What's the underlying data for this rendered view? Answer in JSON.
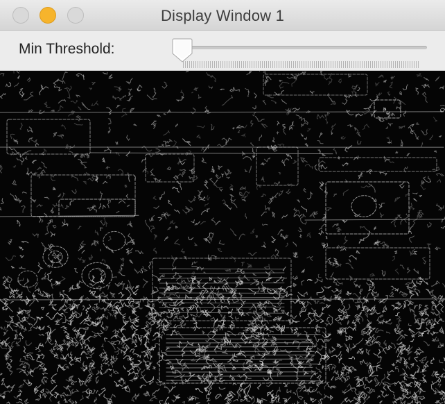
{
  "window": {
    "title": "Display Window 1",
    "buttons": {
      "close_color": "#d9d9d9",
      "minimize_color": "#f6b42c",
      "zoom_color": "#d9d9d9"
    }
  },
  "toolbar": {
    "slider_label": "Min Threshold:",
    "slider_value_fraction": 0
  },
  "image_view": {
    "content": "edge-detection-output",
    "background_color": "#050505",
    "edge_color": "#d8d8d8"
  }
}
